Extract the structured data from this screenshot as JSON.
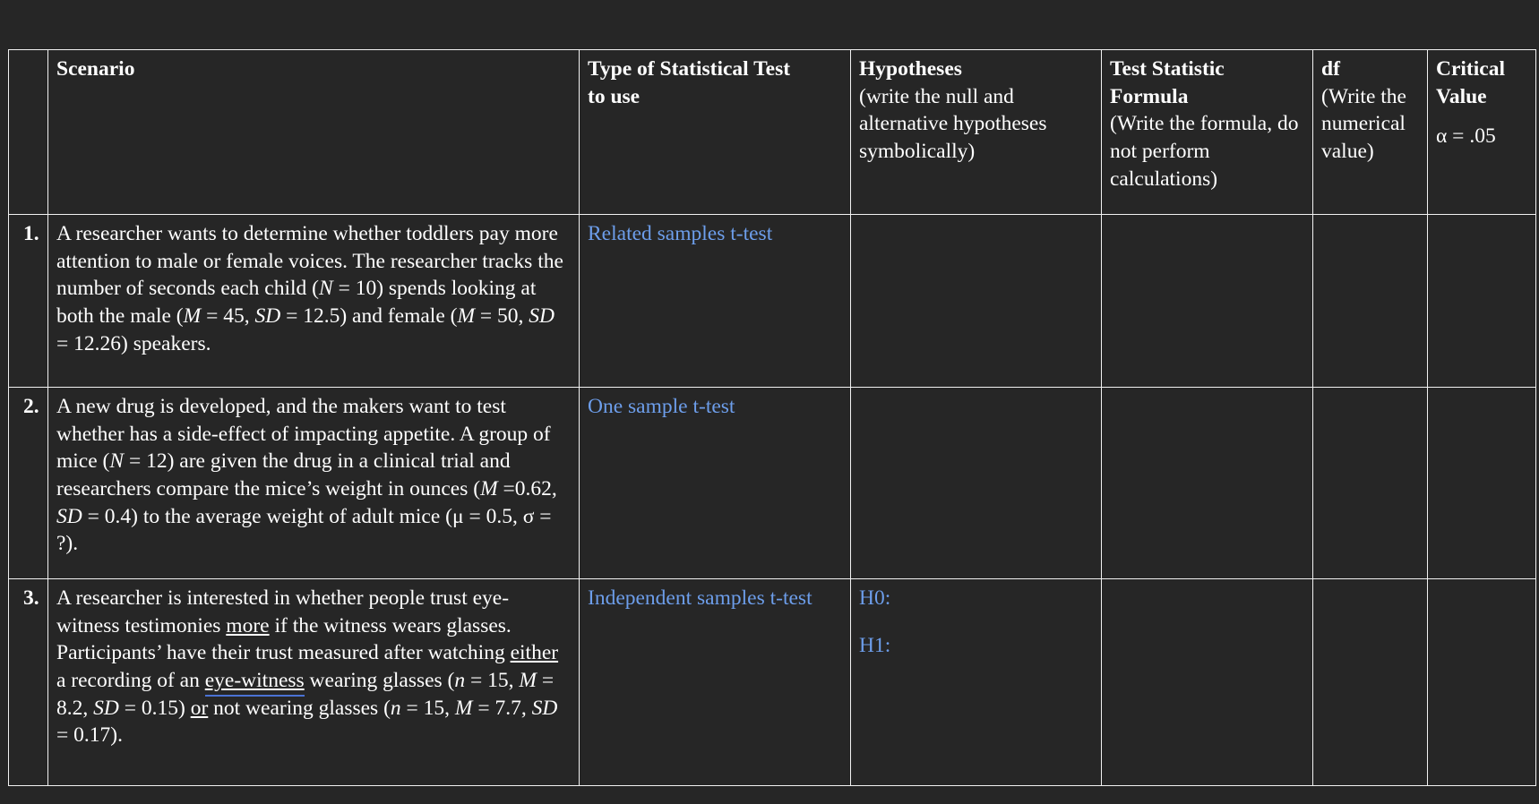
{
  "document": {
    "background_color": "#262626",
    "text_color": "#ffffff",
    "answer_color": "#6d9eeb",
    "border_color": "#f2f2f2"
  },
  "table": {
    "headers": {
      "row_number": "",
      "scenario": "Scenario",
      "test_type_title": "Type of Statistical Test",
      "test_type_title_line2": "to use",
      "hypotheses_title": "Hypotheses",
      "hypotheses_sub": "(write the null and alternative hypotheses symbolically)",
      "statistic_title": "Test Statistic",
      "statistic_title_line2": "Formula",
      "statistic_sub": "(Write the formula, do not perform calculations)",
      "df_title": "df",
      "df_sub": "(Write the numerical value)",
      "critical_title": "Critical",
      "critical_title_line2": "Value",
      "critical_sub": "α = .05"
    },
    "rows": [
      {
        "number": "1.",
        "scenario_parts": {
          "p1": "A researcher wants to determine whether toddlers pay more attention to male or female voices. The researcher tracks the number of seconds each child (",
          "i1": "N",
          "p2": " = 10) spends looking at both the male (",
          "i2": "M",
          "p3": " = 45, ",
          "i3": "SD",
          "p4": " = 12.5) and female (",
          "i4": "M",
          "p5": " = 50, ",
          "i5": "SD",
          "p6": " = 12.26) speakers."
        },
        "test_type": "Related samples t-test",
        "hypotheses": "",
        "statistic_formula": "",
        "df": "",
        "critical_value": ""
      },
      {
        "number": "2.",
        "scenario_parts": {
          "p1": "A new drug is developed, and the makers want to test whether has a side-effect of impacting appetite. A group of mice (",
          "i1": "N",
          "p2": " = 12) are given the drug in a clinical trial and researchers compare the mice’s weight in ounces (",
          "i2": "M",
          "p3": " =0.62, ",
          "i3": "SD",
          "p4": " = 0.4) to the average weight of adult mice (μ = 0.5, σ = ?).",
          "i4": "",
          "p5": "",
          "i5": "",
          "p6": ""
        },
        "test_type": "One sample t-test",
        "hypotheses": "",
        "statistic_formula": "",
        "df": "",
        "critical_value": ""
      },
      {
        "number": "3.",
        "scenario_parts": {
          "p1": "A researcher is interested in whether people trust eye-witness testimonies ",
          "u1": "more",
          "p2": " if the witness wears glasses. Participants’ have their trust measured after watching ",
          "u2": "either",
          "p3": " a recording of an ",
          "u3": "eye-witness",
          "p4": " wearing glasses (",
          "i1": "n",
          "p5": " = 15, ",
          "i2": "M",
          "p6": " = 8.2, ",
          "i3": "SD",
          "p7": " = 0.15) ",
          "u4": "or",
          "p8": " not wearing glasses (",
          "i4": "n",
          "p9": " = 15, ",
          "i5": "M",
          "p10": " = 7.7, ",
          "i6": "SD",
          "p11": " = 0.17)."
        },
        "test_type": "Independent samples t-test",
        "hypotheses_null": "H0:",
        "hypotheses_alt": "H1:",
        "statistic_formula": "",
        "df": "",
        "critical_value": ""
      }
    ]
  }
}
